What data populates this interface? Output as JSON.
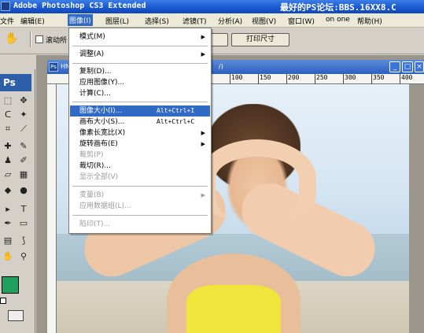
{
  "titlebar": {
    "title": "Adobe Photoshop CS3 Extended",
    "forum": "最好的PS论坛:BBS.16XX8.C"
  },
  "menubar": {
    "items": [
      "文件",
      "编辑(E)",
      "图像(I)",
      "图层(L)",
      "选择(S)",
      "滤镜(T)",
      "分析(A)",
      "视图(V)",
      "窗口(W)",
      "on one",
      "帮助(H)"
    ]
  },
  "options": {
    "scroll_all_label": "滚动所",
    "print_size_button": "打印尺寸"
  },
  "toolbox": {
    "logo": "Ps",
    "foreground_color": "#1fa05f",
    "background_color": "#ffffff"
  },
  "document": {
    "tab_name": "HN",
    "tab_tail": "/)",
    "ruler_marks": [
      "100",
      "150",
      "200",
      "250",
      "300",
      "350",
      "400",
      "450"
    ]
  },
  "image_menu": {
    "items": [
      {
        "label": "模式(M)",
        "shortcut": "",
        "submenu": true,
        "disabled": false
      },
      {
        "label": "调整(A)",
        "shortcut": "",
        "submenu": true,
        "disabled": false
      },
      {
        "label": "复制(D)...",
        "shortcut": "",
        "submenu": false,
        "disabled": false
      },
      {
        "label": "应用图像(Y)...",
        "shortcut": "",
        "submenu": false,
        "disabled": false
      },
      {
        "label": "计算(C)...",
        "shortcut": "",
        "submenu": false,
        "disabled": false
      },
      {
        "label": "图像大小(I)...",
        "shortcut": "Alt+Ctrl+I",
        "submenu": false,
        "disabled": false,
        "highlight": true
      },
      {
        "label": "画布大小(S)...",
        "shortcut": "Alt+Ctrl+C",
        "submenu": false,
        "disabled": false
      },
      {
        "label": "像素长宽比(X)",
        "shortcut": "",
        "submenu": true,
        "disabled": false
      },
      {
        "label": "旋转画布(E)",
        "shortcut": "",
        "submenu": true,
        "disabled": false
      },
      {
        "label": "裁剪(P)",
        "shortcut": "",
        "submenu": false,
        "disabled": true
      },
      {
        "label": "裁切(R)...",
        "shortcut": "",
        "submenu": false,
        "disabled": false
      },
      {
        "label": "显示全部(V)",
        "shortcut": "",
        "submenu": false,
        "disabled": true
      },
      {
        "label": "变量(B)",
        "shortcut": "",
        "submenu": true,
        "disabled": true
      },
      {
        "label": "应用数据组(L)...",
        "shortcut": "",
        "submenu": false,
        "disabled": true
      },
      {
        "label": "陷印(T)...",
        "shortcut": "",
        "submenu": false,
        "disabled": true
      }
    ]
  }
}
